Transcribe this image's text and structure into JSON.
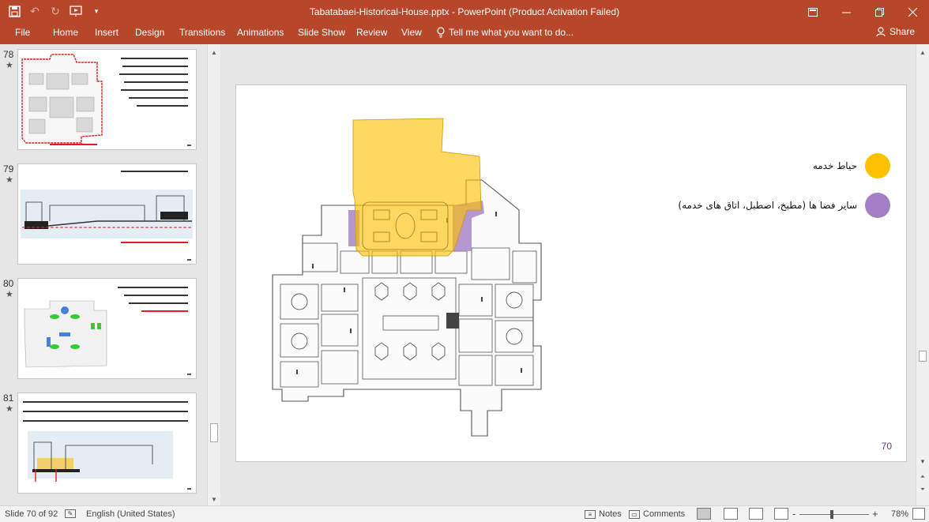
{
  "app": {
    "document_title": "Tabatabaei-Historical-House.pptx  -  PowerPoint (Product Activation Failed)"
  },
  "quick_access": {
    "save_icon": "save-icon",
    "undo_icon": "undo-icon",
    "redo_icon": "redo-icon",
    "start_icon": "start-from-beginning-icon",
    "customize_icon": "customize-icon"
  },
  "window_controls": {
    "ribbon_options_icon": "ribbon-display-options-icon",
    "minimize_icon": "minimize-icon",
    "restore_icon": "restore-icon",
    "close_icon": "close-icon"
  },
  "ribbon": {
    "tabs": [
      "File",
      "Home",
      "Insert",
      "Design",
      "Transitions",
      "Animations",
      "Slide Show",
      "Review",
      "View"
    ],
    "tell_me": "Tell me what you want to do...",
    "share": "Share"
  },
  "thumbnails": [
    {
      "number": "78",
      "star": "★"
    },
    {
      "number": "79",
      "star": "★"
    },
    {
      "number": "80",
      "star": "★"
    },
    {
      "number": "81",
      "star": "★"
    }
  ],
  "slide": {
    "legend": [
      {
        "label": "حیاط خدمه",
        "color": "#ffc000"
      },
      {
        "label": "سایر فضا ها (مطبخ، اصطبل، اتاق های خدمه)",
        "color": "#a47fc6"
      }
    ],
    "page_number": "70"
  },
  "status": {
    "slide_info": "Slide 70 of 92",
    "language": "English (United States)",
    "notes": "Notes",
    "comments": "Comments",
    "zoom_minus": "-",
    "zoom_plus": "+",
    "zoom_level": "78%"
  },
  "colors": {
    "ribbon": "#b7472a",
    "service_yard": "#ffc000",
    "service_spaces": "#a47fc6",
    "slide_number": "#7030a0"
  }
}
